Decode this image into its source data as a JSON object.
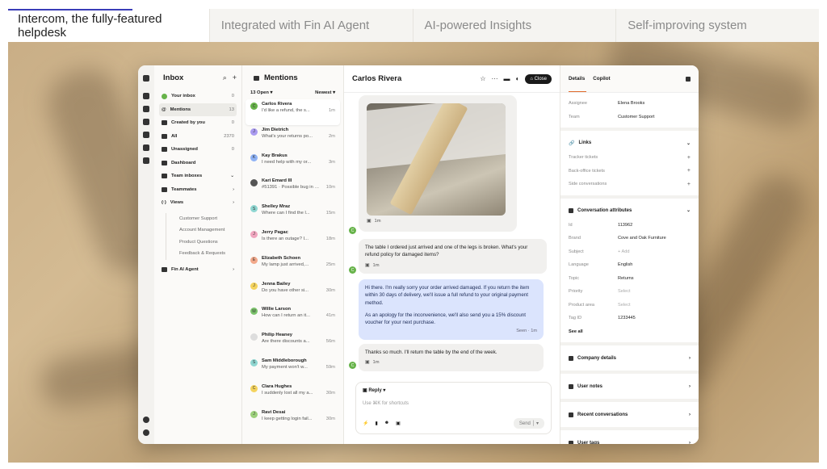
{
  "tabs": [
    {
      "label": "Intercom, the fully-featured helpdesk",
      "active": true
    },
    {
      "label": "Integrated with Fin AI Agent",
      "active": false
    },
    {
      "label": "AI-powered Insights",
      "active": false
    },
    {
      "label": "Self-improving system",
      "active": false
    }
  ],
  "inbox": {
    "title": "Inbox",
    "items": [
      {
        "label": "Your inbox",
        "count": "0",
        "icon": "avatar-icon"
      },
      {
        "label": "Mentions",
        "count": "13",
        "icon": "at-icon"
      },
      {
        "label": "Created by you",
        "count": "0",
        "icon": "pencil-icon"
      },
      {
        "label": "All",
        "count": "2370",
        "icon": "people-icon"
      },
      {
        "label": "Unassigned",
        "count": "0",
        "icon": "unassigned-icon"
      },
      {
        "label": "Dashboard",
        "count": "",
        "icon": "dashboard-icon"
      },
      {
        "label": "Team inboxes",
        "count": "",
        "icon": "inbox-icon"
      },
      {
        "label": "Teammates",
        "count": "",
        "icon": "teammates-icon"
      },
      {
        "label": "Views",
        "count": "",
        "icon": "views-icon"
      }
    ],
    "views": [
      "Customer Support",
      "Account Management",
      "Product Questions",
      "Feedback & Requests"
    ],
    "fin": "Fin AI Agent"
  },
  "mentions": {
    "title": "Mentions",
    "filter": "13 Open",
    "sort": "Newest",
    "items": [
      {
        "name": "Carlos Rivera",
        "preview": "I'd like a refund, the s...",
        "time": "1m",
        "initial": "C",
        "color": "#67b34a"
      },
      {
        "name": "Jim Dietrich",
        "preview": "What's your returns po...",
        "time": "2m",
        "initial": "J",
        "color": "#a99af0"
      },
      {
        "name": "Kay Brakus",
        "preview": "I need help with my or...",
        "time": "3m",
        "initial": "K",
        "color": "#8fb2f5"
      },
      {
        "name": "Kari Emard III",
        "preview": "#51391 · Possible bug in order update screen",
        "time": "10m",
        "initial": "",
        "color": "#555555"
      },
      {
        "name": "Shelley Mraz",
        "preview": "Where can I find the l...",
        "time": "15m",
        "initial": "S",
        "color": "#8fd6d1"
      },
      {
        "name": "Jerry Pagac",
        "preview": "Is there an outage? I...",
        "time": "18m",
        "initial": "J",
        "color": "#f0a6bf"
      },
      {
        "name": "Elizabeth Schoen",
        "preview": "My lamp just arrived,...",
        "time": "25m",
        "initial": "E",
        "color": "#f3a98b"
      },
      {
        "name": "Jenna Bailey",
        "preview": "Do you have other si...",
        "time": "30m",
        "initial": "J",
        "color": "#f4d35e"
      },
      {
        "name": "Willie Larson",
        "preview": "How can I return an it...",
        "time": "41m",
        "initial": "W",
        "color": "#7cc36c"
      },
      {
        "name": "Philip Heaney",
        "preview": "Are there discounts a...",
        "time": "56m",
        "initial": "",
        "color": "#dddddd"
      },
      {
        "name": "Sam Middleborough",
        "preview": "My payment won't w...",
        "time": "59m",
        "initial": "S",
        "color": "#8fd6d1"
      },
      {
        "name": "Clara Hughes",
        "preview": "I suddenly lost all my a...",
        "time": "30m",
        "initial": "C",
        "color": "#f4d35e"
      },
      {
        "name": "Ravi Desai",
        "preview": "I keep getting login fail...",
        "time": "30m",
        "initial": "J",
        "color": "#9cd07b"
      }
    ]
  },
  "chat": {
    "name": "Carlos Rivera",
    "close": "Close",
    "image_time": "1m",
    "msg1": "The table I ordered just arrived and one of the legs is broken. What's your refund policy for damaged items?",
    "msg1_time": "1m",
    "msg2a": "Hi there. I'm really sorry your order arrived damaged. If you return the item within 30 days of delivery, we'll issue a full refund to your original payment method.",
    "msg2b": "As an apology for the inconvenience, we'll also send you a 15% discount voucher for your next purchase.",
    "msg2_meta": "Seen · 1m",
    "msg3": "Thanks so much. I'll return the table by the end of the week.",
    "msg3_time": "1m",
    "reply_label": "Reply",
    "reply_placeholder": "Use ⌘K for shortcuts",
    "send": "Send"
  },
  "details": {
    "tab_details": "Details",
    "tab_copilot": "Copilot",
    "assignee_k": "Assignee",
    "assignee_v": "Elena Brooks",
    "team_k": "Team",
    "team_v": "Customer Support",
    "links_title": "Links",
    "links": [
      "Tracker tickets",
      "Back-office tickets",
      "Side conversations"
    ],
    "attr_title": "Conversation attributes",
    "attrs": [
      {
        "k": "Id",
        "v": "113962"
      },
      {
        "k": "Brand",
        "v": "Cove and Oak Furniture"
      },
      {
        "k": "Subject",
        "v": "+ Add"
      },
      {
        "k": "Language",
        "v": "English"
      },
      {
        "k": "Topic",
        "v": "Returns"
      },
      {
        "k": "Priority",
        "v": "Select"
      },
      {
        "k": "Product area",
        "v": "Select"
      },
      {
        "k": "Tag ID",
        "v": "1233445"
      }
    ],
    "see_all": "See all",
    "sections": [
      "Company details",
      "User notes",
      "Recent conversations",
      "User tags"
    ]
  }
}
